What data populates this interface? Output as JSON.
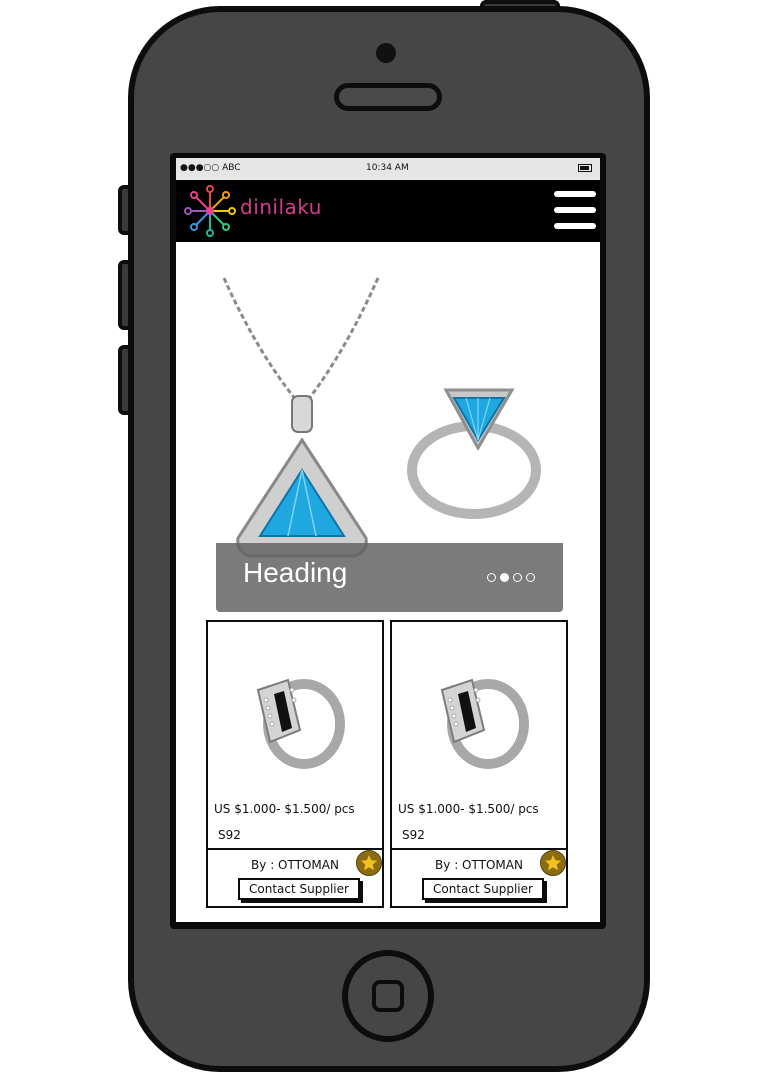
{
  "status_bar": {
    "carrier": "●●●○○ ABC",
    "time": "10:34 AM"
  },
  "header": {
    "logo_text": "dinilaku",
    "menu_icon": "hamburger-icon"
  },
  "carousel": {
    "heading": "Heading",
    "slide_count": 4,
    "active_slide": 2
  },
  "products": [
    {
      "price": "US $1.000- $1.500/ pcs",
      "code": "S92",
      "supplier": "By : OTTOMAN",
      "contact_label": "Contact Supplier",
      "badge_icon": "star-icon"
    },
    {
      "price": "US $1.000- $1.500/ pcs",
      "code": "S92",
      "supplier": "By : OTTOMAN",
      "contact_label": "Contact Supplier",
      "badge_icon": "star-icon"
    }
  ],
  "colors": {
    "phone_body": "#464646",
    "topbar": "#000000",
    "logo_text": "#d43c8a",
    "badge": "#8a6d12",
    "star": "#f4c21c",
    "gem": "#1fa8e0"
  }
}
